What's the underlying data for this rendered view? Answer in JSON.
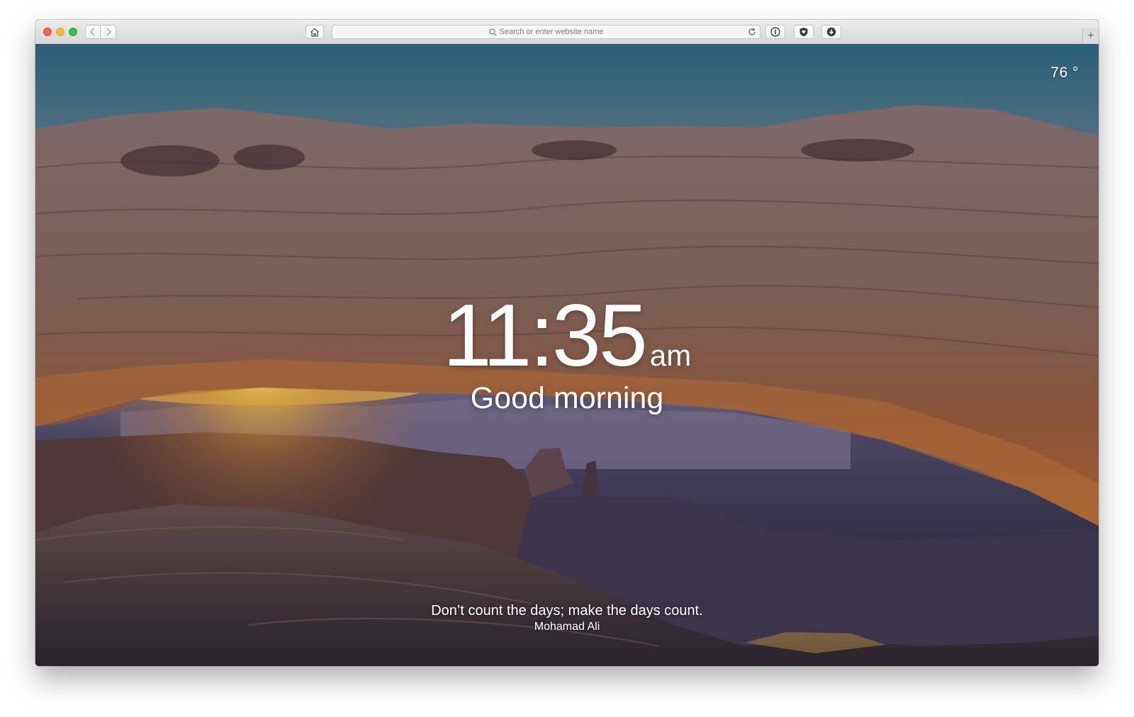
{
  "toolbar": {
    "address_placeholder": "Search or enter website name",
    "new_tab_symbol": "+",
    "icons": [
      "close-light",
      "minimize-light",
      "zoom-light",
      "back-icon",
      "forward-icon",
      "home-icon",
      "search-icon",
      "reload-icon",
      "info-icon",
      "shield-icon",
      "download-icon",
      "plus-icon"
    ]
  },
  "weather": {
    "temperature": "76 °"
  },
  "clock": {
    "time": "11:35",
    "period": "am"
  },
  "greeting": "Good morning",
  "quote": {
    "text": "Don’t count the days; make the days count.",
    "author": "Mohamad Ali"
  },
  "colors": {
    "traffic_red": "#fc5f57",
    "traffic_yellow": "#fdbc2e",
    "traffic_green": "#33c748",
    "overlay_text": "#ffffff"
  }
}
